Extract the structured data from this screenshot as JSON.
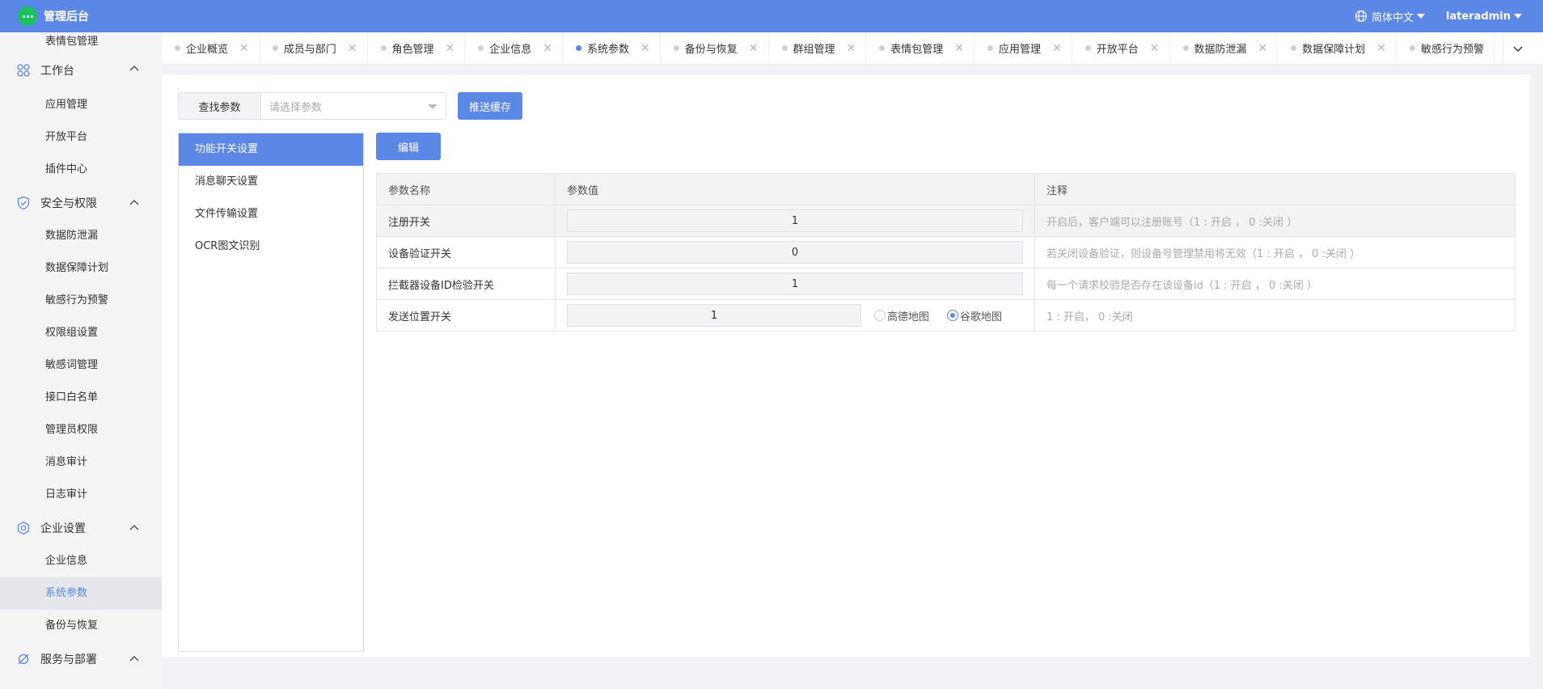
{
  "app": {
    "title": "管理后台"
  },
  "header": {
    "language": "简体中文",
    "user": "lateradmin"
  },
  "sidebar": {
    "top_item": "表情包管理",
    "groups": [
      {
        "label": "工作台",
        "icon": "grid-icon",
        "items": [
          "应用管理",
          "开放平台",
          "插件中心"
        ]
      },
      {
        "label": "安全与权限",
        "icon": "shield-icon",
        "items": [
          "数据防泄漏",
          "数据保障计划",
          "敏感行为预警",
          "权限组设置",
          "敏感词管理",
          "接口白名单",
          "管理员权限",
          "消息审计",
          "日志审计"
        ]
      },
      {
        "label": "企业设置",
        "icon": "settings-hexagon-icon",
        "items": [
          "企业信息",
          "系统参数",
          "备份与恢复"
        ]
      },
      {
        "label": "服务与部署",
        "icon": "orbit-icon",
        "items": []
      }
    ],
    "active_item": "系统参数"
  },
  "tabs": [
    {
      "label": "企业概览",
      "active": false
    },
    {
      "label": "成员与部门",
      "active": false
    },
    {
      "label": "角色管理",
      "active": false
    },
    {
      "label": "企业信息",
      "active": false
    },
    {
      "label": "系统参数",
      "active": true
    },
    {
      "label": "备份与恢复",
      "active": false
    },
    {
      "label": "群组管理",
      "active": false
    },
    {
      "label": "表情包管理",
      "active": false
    },
    {
      "label": "应用管理",
      "active": false
    },
    {
      "label": "开放平台",
      "active": false
    },
    {
      "label": "数据防泄漏",
      "active": false
    },
    {
      "label": "数据保障计划",
      "active": false
    },
    {
      "label": "敏感行为预警",
      "active": false
    }
  ],
  "search": {
    "label": "查找参数",
    "placeholder": "请选择参数",
    "push_button": "推送缓存"
  },
  "settings_menu": {
    "items": [
      "功能开关设置",
      "消息聊天设置",
      "文件传输设置",
      "OCR图文识别"
    ],
    "active_index": 0
  },
  "edit_button": "编辑",
  "table": {
    "headers": {
      "name": "参数名称",
      "value": "参数值",
      "note": "注释"
    },
    "rows": [
      {
        "name": "注册开关",
        "value": "1",
        "note": "开启后，客户端可以注册账号（1 : 开启 ， 0 :关闭 ）"
      },
      {
        "name": "设备验证开关",
        "value": "0",
        "note": "若关闭设备验证，则设备号管理禁用将无效（1 : 开启 ， 0 :关闭 ）"
      },
      {
        "name": "拦截器设备ID检验开关",
        "value": "1",
        "note": "每一个请求校验是否存在该设备id（1 : 开启 ， 0 :关闭 ）"
      }
    ],
    "location_row": {
      "name": "发送位置开关",
      "value": "1",
      "options": [
        {
          "label": "高德地图",
          "checked": false
        },
        {
          "label": "谷歌地图",
          "checked": true
        }
      ],
      "note": "1 : 开启， 0 :关闭"
    }
  },
  "colors": {
    "primary": "#5b87e6",
    "brand_green": "#19c15f",
    "sidebar_bg": "#f4f4f5",
    "page_bg": "#f0f2f5"
  }
}
